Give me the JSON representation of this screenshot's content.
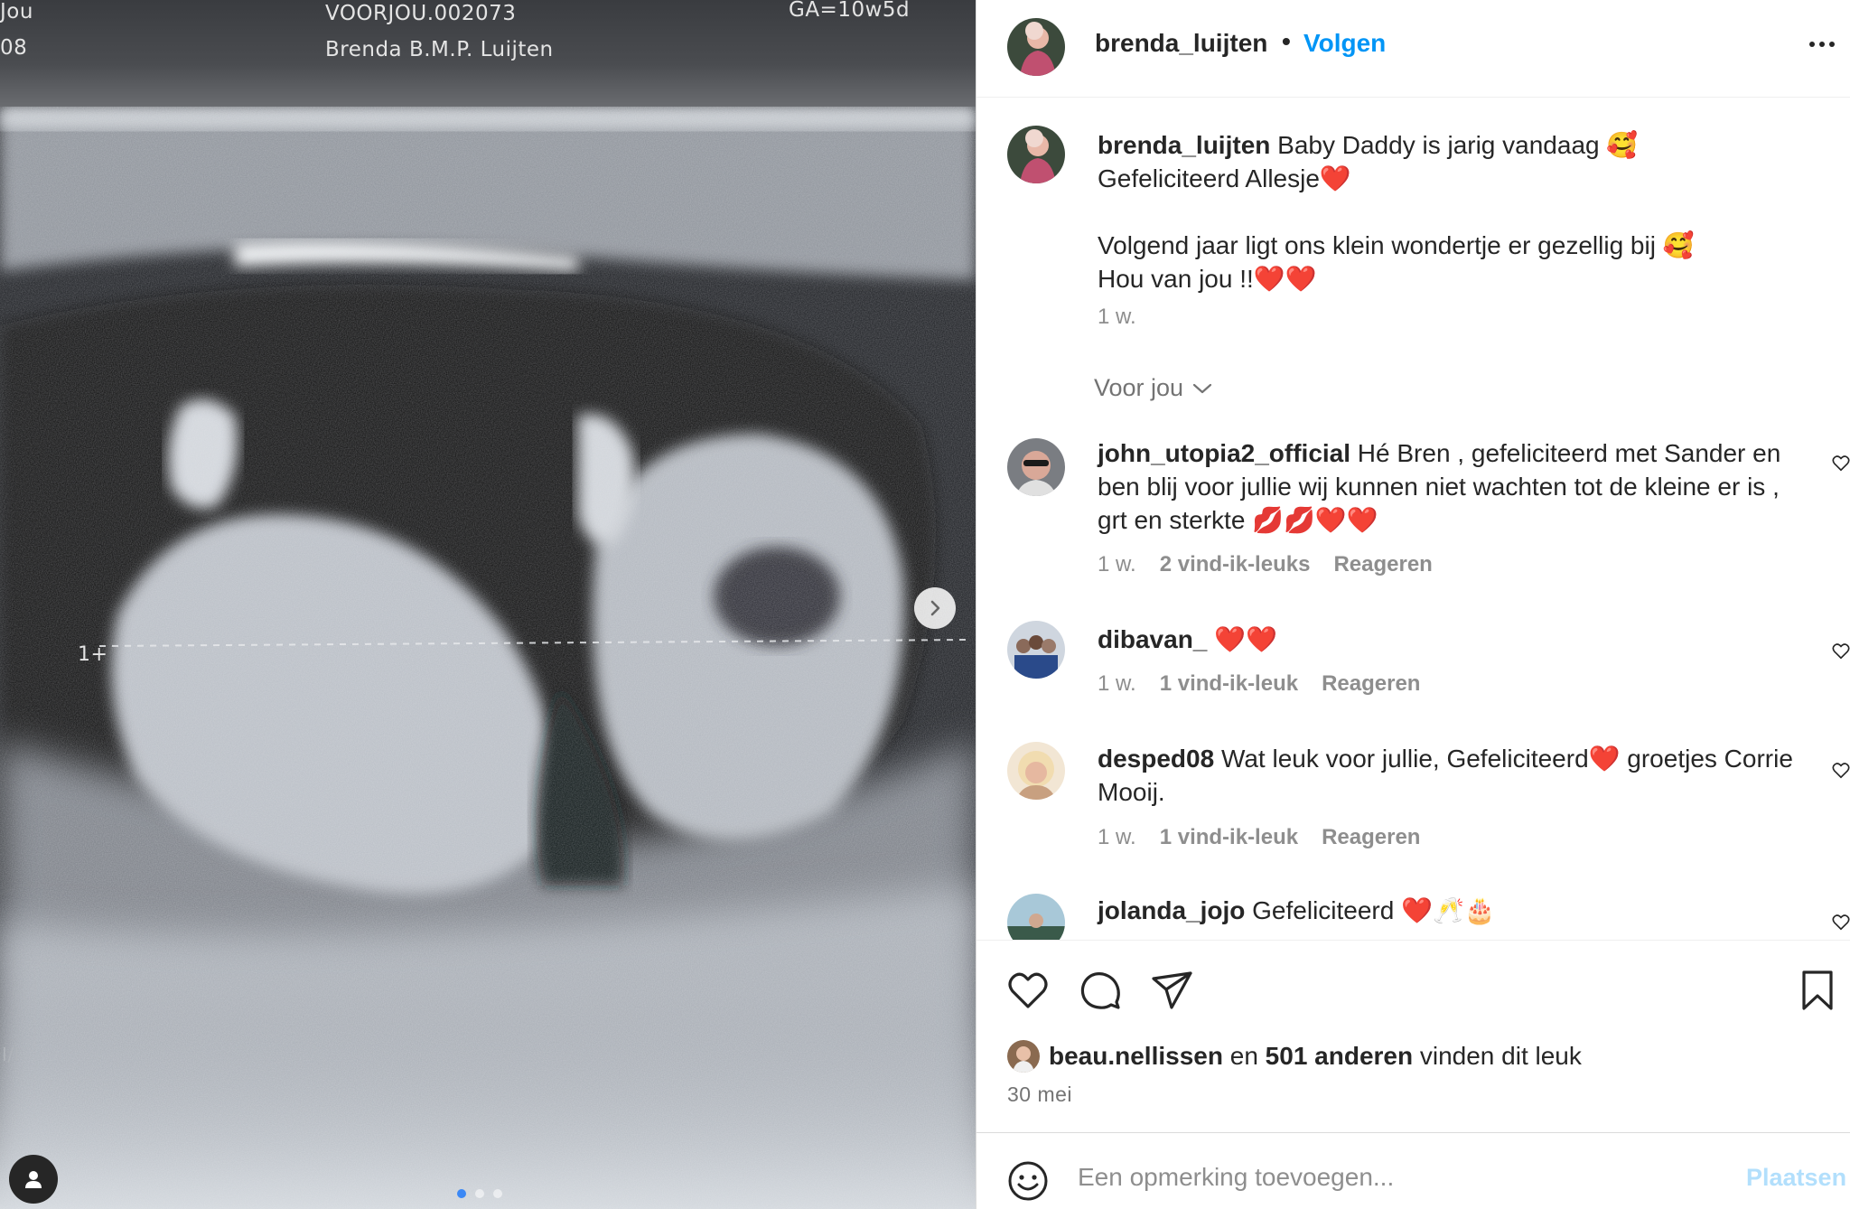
{
  "media": {
    "scan_labels": {
      "top_left": "Jou",
      "mid_left": "08",
      "patient_id": "VOORJOU.002073",
      "patient_name": "Brenda B.M.P. Luijten",
      "gestation": "GA=10w5d",
      "marker": "1+",
      "side_mark": "I/I"
    },
    "carousel": {
      "count": 3,
      "active_index": 0
    },
    "next_icon": "chevron-right-icon",
    "tagged_icon": "person-icon"
  },
  "header": {
    "username": "brenda_luijten",
    "separator": "•",
    "follow_label": "Volgen",
    "more_icon": "more-horizontal-icon"
  },
  "caption": {
    "username": "brenda_luijten",
    "line1": " Baby Daddy is jarig vandaag 🥰",
    "line2": "Gefeliciteerd Allesje",
    "line2_emoji": "❤️",
    "line3": "Volgend jaar ligt ons klein wondertje er gezellig bij 🥰",
    "line4": "Hou van jou !!",
    "line4_emoji": "❤️❤️",
    "time": "1 w."
  },
  "voor_jou": {
    "label": "Voor jou",
    "icon": "chevron-down-icon"
  },
  "comments": [
    {
      "username": "john_utopia2_official",
      "text": " Hé Bren , gefeliciteerd met Sander en ben blij voor jullie wij kunnen niet wachten tot de kleine er is , grt en sterkte 💋💋❤️❤️",
      "time": "1 w.",
      "likes": "2 vind-ik-leuks",
      "reply": "Reageren"
    },
    {
      "username": "dibavan_",
      "text": " ❤️❤️",
      "time": "1 w.",
      "likes": "1 vind-ik-leuk",
      "reply": "Reageren"
    },
    {
      "username": "desped08",
      "text": " Wat leuk voor jullie, Gefeliciteerd❤️ groetjes Corrie Mooij.",
      "time": "1 w.",
      "likes": "1 vind-ik-leuk",
      "reply": "Reageren"
    },
    {
      "username": "jolanda_jojo",
      "text": " Gefeliciteerd ❤️🥂🎂"
    }
  ],
  "actions": {
    "like_icon": "heart-icon",
    "comment_icon": "comment-icon",
    "share_icon": "send-icon",
    "save_icon": "bookmark-icon"
  },
  "likes_summary": {
    "first_liker": "beau.nellissen",
    "connector": " en ",
    "others": "501 anderen",
    "suffix": " vinden dit leuk"
  },
  "post_date": "30 mei",
  "add_comment": {
    "placeholder": "Een opmerking toevoegen...",
    "post_label": "Plaatsen",
    "emoji_icon": "smiley-icon"
  },
  "colors": {
    "accent": "#0095f6",
    "post_disabled": "#b2dffc",
    "secondary_text": "#8e8e8e",
    "divider": "#dbdbdb"
  }
}
